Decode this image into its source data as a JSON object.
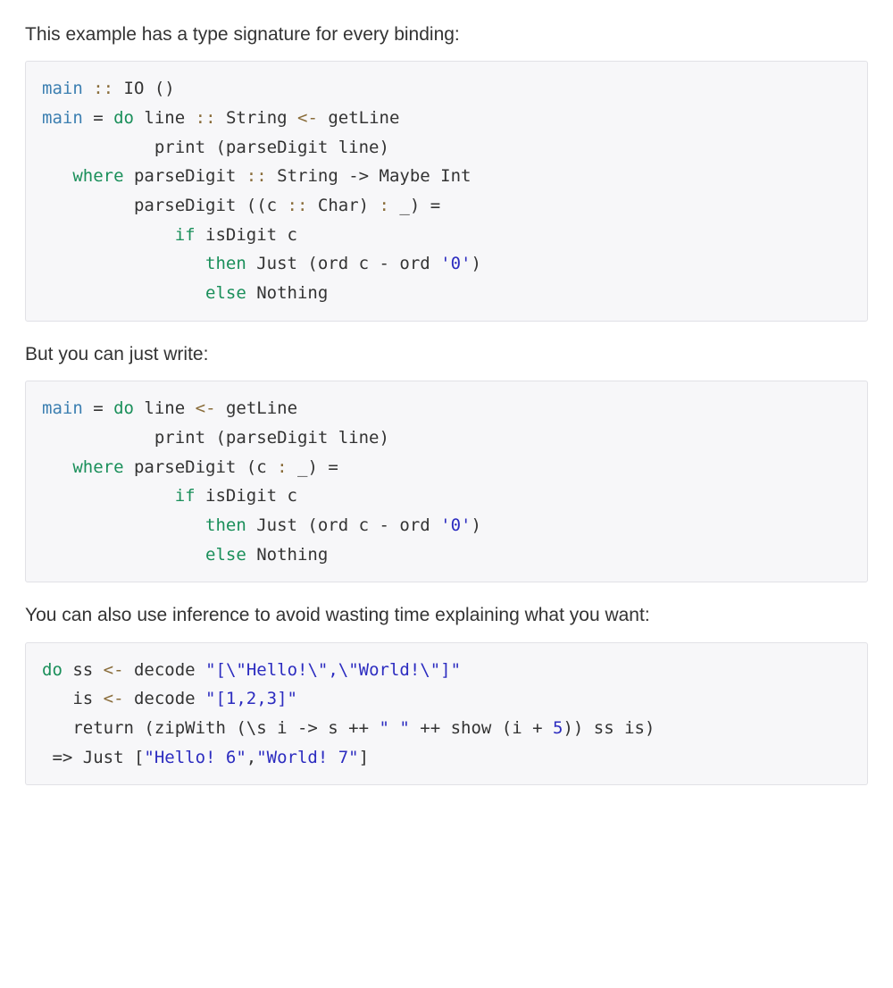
{
  "paragraphs": {
    "p1": "This example has a type signature for every binding:",
    "p2": "But you can just write:",
    "p3": "You can also use inference to avoid wasting time explaining what you want:"
  },
  "code1": {
    "l1_main": "main",
    "l1_colcol": " :: ",
    "l1_io": "IO ()",
    "l2_main": "main",
    "l2_eq": " = ",
    "l2_do": "do",
    "l2_sp": " line ",
    "l2_colcol": ":: ",
    "l2_string": "String ",
    "l2_arrow": "<-",
    "l2_getline": " getLine",
    "l3": "           print (parseDigit line)",
    "l4_where": "   where",
    "l4_sp": " parseDigit ",
    "l4_colcol": ":: ",
    "l4_sig": "String -> Maybe Int",
    "l5_lead": "         parseDigit ((c ",
    "l5_colcol": ":: ",
    "l5_char": "Char) ",
    "l5_cons": ":",
    "l5_rest": " _) =",
    "l6_lead": "             ",
    "l6_if": "if",
    "l6_rest": " isDigit c",
    "l7_lead": "                ",
    "l7_then": "then",
    "l7_mid": " Just (ord c - ord ",
    "l7_str": "'0'",
    "l7_end": ")",
    "l8_lead": "                ",
    "l8_else": "else",
    "l8_rest": " Nothing"
  },
  "code2": {
    "l1_main": "main",
    "l1_eq": " = ",
    "l1_do": "do",
    "l1_sp": " line ",
    "l1_arrow": "<-",
    "l1_getline": " getLine",
    "l2": "           print (parseDigit line)",
    "l3_where": "   where",
    "l3_sp": " parseDigit (c ",
    "l3_cons": ":",
    "l3_rest": " _) =",
    "l4_lead": "             ",
    "l4_if": "if",
    "l4_rest": " isDigit c",
    "l5_lead": "                ",
    "l5_then": "then",
    "l5_mid": " Just (ord c - ord ",
    "l5_str": "'0'",
    "l5_end": ")",
    "l6_lead": "                ",
    "l6_else": "else",
    "l6_rest": " Nothing"
  },
  "code3": {
    "l1_do": "do",
    "l1_sp": " ss ",
    "l1_arrow": "<-",
    "l1_mid": " decode ",
    "l1_str": "\"[\\\"Hello!\\\",\\\"World!\\\"]\"",
    "l2_lead": "   is ",
    "l2_arrow": "<-",
    "l2_mid": " decode ",
    "l2_str": "\"[1,2,3]\"",
    "l3_lead": "   return (zipWith (\\s i -> s ++ ",
    "l3_str": "\" \"",
    "l3_mid": " ++ show (i + ",
    "l3_num": "5",
    "l3_end": ")) ss is)",
    "l4_lead": " => Just [",
    "l4_s1": "\"Hello! 6\"",
    "l4_comma": ",",
    "l4_s2": "\"World! 7\"",
    "l4_end": "]"
  }
}
